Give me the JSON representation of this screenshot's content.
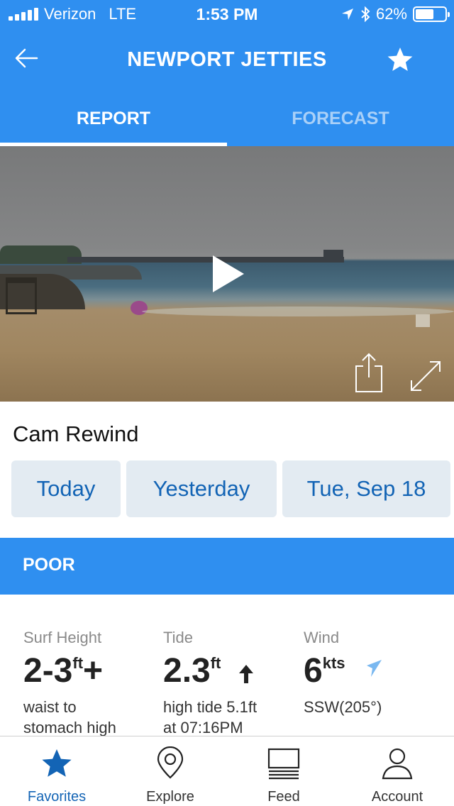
{
  "status_bar": {
    "carrier": "Verizon",
    "network": "LTE",
    "time": "1:53 PM",
    "battery": "62%",
    "battery_level": 0.62
  },
  "header": {
    "title": "NEWPORT JETTIES",
    "back_icon": "arrow-left-icon",
    "favorite_icon": "star-icon"
  },
  "tabs": [
    {
      "label": "REPORT",
      "active": true
    },
    {
      "label": "FORECAST",
      "active": false
    }
  ],
  "cam": {
    "play_icon": "play-icon",
    "share_icon": "share-icon",
    "fullscreen_icon": "expand-icon"
  },
  "cam_rewind": {
    "title": "Cam Rewind",
    "options": [
      "Today",
      "Yesterday",
      "Tue, Sep 18"
    ]
  },
  "rating": {
    "label": "POOR"
  },
  "conditions": {
    "surf": {
      "label": "Surf Height",
      "value": "2-3",
      "unit": "ft",
      "suffix": "+",
      "desc_line1": "waist to",
      "desc_line2": "stomach high"
    },
    "tide": {
      "label": "Tide",
      "value": "2.3",
      "unit": "ft",
      "trend_icon": "arrow-up-icon",
      "desc_line1": "high tide 5.1ft",
      "desc_line2": "at 07:16PM"
    },
    "wind": {
      "label": "Wind",
      "value": "6",
      "unit": "kts",
      "direction_icon": "wind-direction-arrow-icon",
      "desc_line1": "SSW(205°)"
    }
  },
  "bottom_nav": [
    {
      "label": "Favorites",
      "icon": "star-icon",
      "active": true
    },
    {
      "label": "Explore",
      "icon": "map-pin-icon",
      "active": false
    },
    {
      "label": "Feed",
      "icon": "feed-icon",
      "active": false
    },
    {
      "label": "Account",
      "icon": "user-icon",
      "active": false
    }
  ],
  "colors": {
    "brand_blue": "#2f8ff0",
    "button_bg": "#e3ebf2",
    "link_blue": "#1364b5",
    "inactive_tab": "#a9d0f8",
    "wind_arrow": "#7ab8f0"
  }
}
